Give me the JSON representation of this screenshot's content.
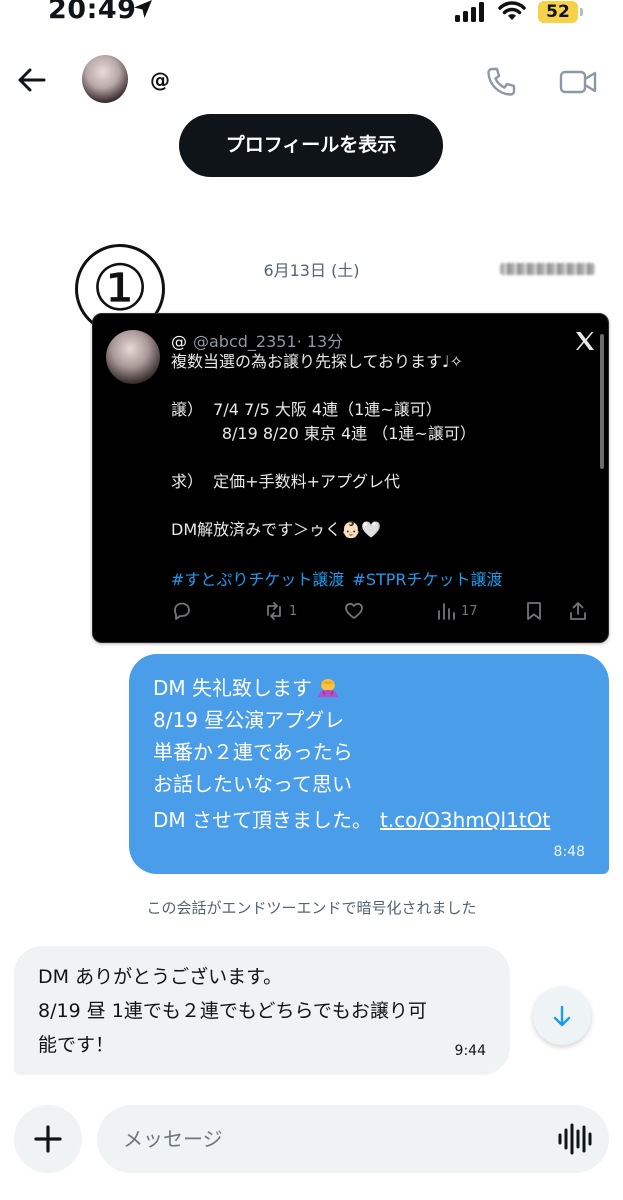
{
  "status_bar": {
    "time": "20:49",
    "battery": "52"
  },
  "header": {
    "contact_name": "@",
    "profile_button": "プロフィールを表示"
  },
  "annotation": {
    "circled_number": "①"
  },
  "conversation": {
    "date": "6月13日 (土)"
  },
  "tweet": {
    "handle_prefix": "@",
    "handle": "@abcd_2351",
    "time": "· 13分",
    "body": "複数当選の為お譲り先探しております♩✧\n\n譲）  7/4 7/5 大阪 4連（1連~譲可）\n          8/19 8/20 東京 4連 （1連~譲可）\n\n求）  定価+手数料+アプグレ代\n\nDM解放済みです＞ゥく👶🏻🤍",
    "hashtags": [
      "#すとぷりチケット譲渡",
      "#STPRチケット譲渡"
    ],
    "retweets": "1",
    "views": "17"
  },
  "sent_message": {
    "lines": [
      "DM 失礼致します",
      "8/19 昼公演アプグレ",
      "単番か２連であったら",
      "お話したいなって思い",
      "DM させて頂きました。"
    ],
    "link": "t.co/O3hmQl1tOt",
    "time": "8:48"
  },
  "encryption_note": "この会話がエンドツーエンドで暗号化されました",
  "received_message": {
    "lines": [
      "DM ありがとうございます。",
      "8/19 昼 1連でも２連でもどちらでもお譲り可",
      "能です！"
    ],
    "time": "9:44"
  },
  "composer": {
    "placeholder": "メッセージ"
  },
  "colors": {
    "sent_bubble": "#4a9de8",
    "received_bubble": "#eff3f4",
    "link_blue": "#1d9bf0",
    "battery": "#f6d24b"
  }
}
